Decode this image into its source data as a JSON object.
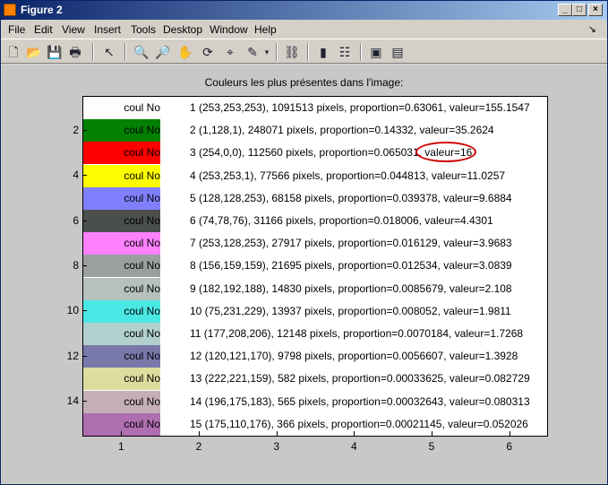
{
  "window": {
    "title": "Figure 2",
    "controls": {
      "minimize": "_",
      "maximize": "□",
      "close": "×"
    }
  },
  "menu": {
    "items": [
      "File",
      "Edit",
      "View",
      "Insert",
      "Tools",
      "Desktop",
      "Window",
      "Help"
    ],
    "dock_arrow": "↘"
  },
  "toolbar": {
    "tools": [
      "new-figure",
      "open-file",
      "save",
      "print",
      "pointer",
      "zoom-in",
      "zoom-out",
      "pan",
      "rotate-3d",
      "data-cursor",
      "brush",
      "link-plot",
      "colorbar",
      "legend",
      "hide-plot-tools",
      "show-plot-tools"
    ]
  },
  "plot": {
    "title": "Couleurs les plus présentes dans l'image:",
    "swatch_label": "coul No",
    "highlighted_row": 3,
    "highlight_color": "#d00000",
    "yticks": [
      "2",
      "4",
      "6",
      "8",
      "10",
      "12",
      "14"
    ],
    "xticks": [
      "1",
      "2",
      "3",
      "4",
      "5",
      "6"
    ],
    "rows": [
      {
        "color": "#fdfdfd",
        "text": "1 (253,253,253), 1091513 pixels, proportion=0.63061, valeur=155.1547"
      },
      {
        "color": "#018001",
        "text": "2 (1,128,1), 248071 pixels, proportion=0.14332, valeur=35.2624"
      },
      {
        "color": "#fe0000",
        "text": "3 (254,0,0), 112560 pixels, proportion=0.065031, valeur=16"
      },
      {
        "color": "#fdfd01",
        "text": "4 (253,253,1), 77566 pixels, proportion=0.044813, valeur=11.0257"
      },
      {
        "color": "#8080fd",
        "text": "5 (128,128,253), 68158 pixels, proportion=0.039378, valeur=9.6884"
      },
      {
        "color": "#4a4e4c",
        "text": "6 (74,78,76), 31166 pixels, proportion=0.018006, valeur=4.4301"
      },
      {
        "color": "#fd80fd",
        "text": "7 (253,128,253), 27917 pixels, proportion=0.016129, valeur=3.9683"
      },
      {
        "color": "#9c9f9f",
        "text": "8 (156,159,159), 21695 pixels, proportion=0.012534, valeur=3.0839"
      },
      {
        "color": "#b6c0bc",
        "text": "9 (182,192,188), 14830 pixels, proportion=0.0085679, valeur=2.108"
      },
      {
        "color": "#4be7e5",
        "text": "10 (75,231,229), 13937 pixels, proportion=0.008052, valeur=1.9811"
      },
      {
        "color": "#b1d0ce",
        "text": "11 (177,208,206), 12148 pixels, proportion=0.0070184, valeur=1.7268"
      },
      {
        "color": "#7879aa",
        "text": "12 (120,121,170), 9798 pixels, proportion=0.0056607, valeur=1.3928"
      },
      {
        "color": "#dedd9f",
        "text": "13 (222,221,159), 582 pixels, proportion=0.00033625, valeur=0.082729"
      },
      {
        "color": "#c4afb7",
        "text": "14 (196,175,183), 565 pixels, proportion=0.00032643, valeur=0.080313"
      },
      {
        "color": "#af6eb0",
        "text": "15 (175,110,176), 366 pixels, proportion=0.00021145, valeur=0.052026"
      }
    ]
  }
}
